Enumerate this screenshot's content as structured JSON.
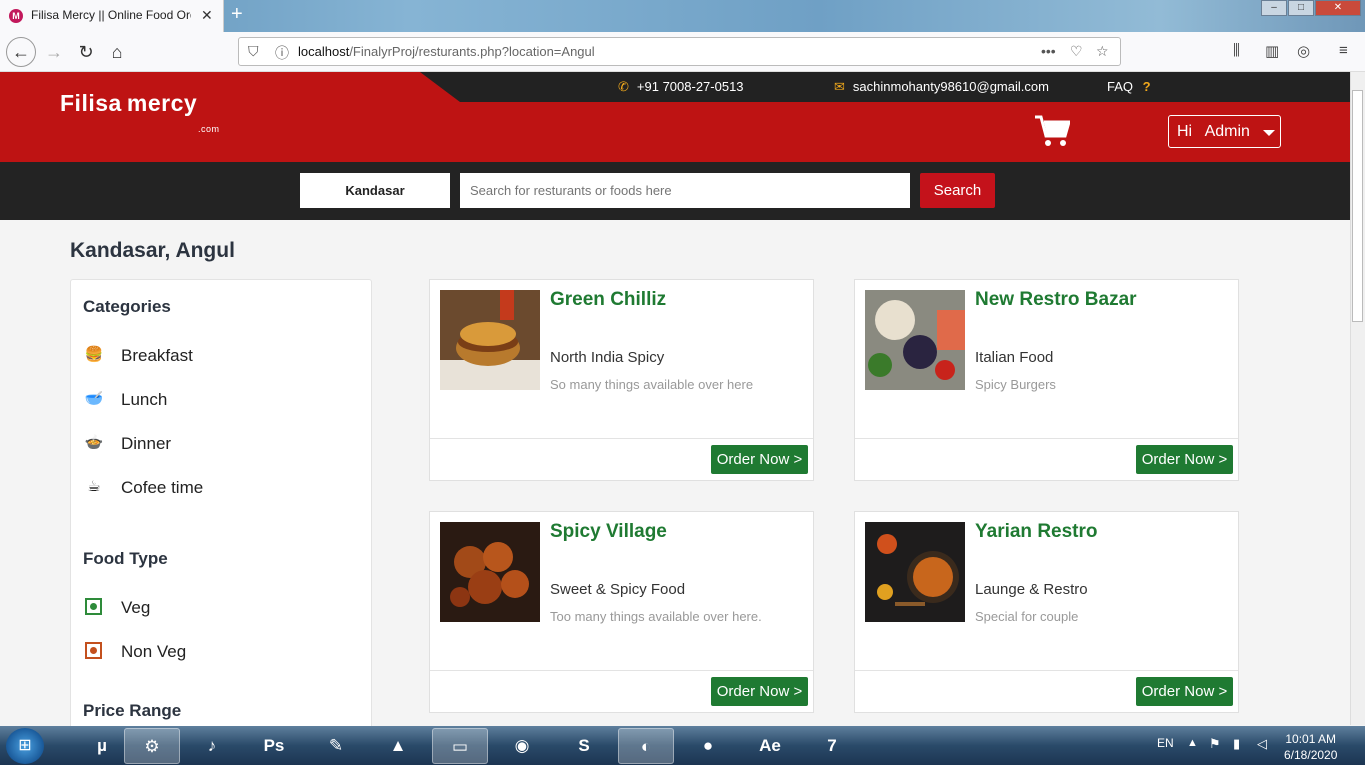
{
  "browser": {
    "tab_title": "Filisa Mercy || Online Food Orde",
    "tab_close": "✕",
    "new_tab": "+",
    "url_prefix": "localhost",
    "url_rest": "/FinalyrProj/resturants.php?location=Angul",
    "window_min": "‒",
    "window_max": "□",
    "window_close": "✕"
  },
  "topbar": {
    "phone": "+91 7008-27-0513",
    "email": "sachinmohanty98610@gmail.com",
    "faq": "FAQ",
    "faq_icon": "?"
  },
  "header": {
    "logo_text": "Filisa mercy",
    "logo_domain": ".com",
    "user_menu": "Hi   Admin"
  },
  "search": {
    "location": "Kandasar",
    "placeholder": "Search for resturants or foods here",
    "button": "Search"
  },
  "page": {
    "title": "Kandasar, Angul"
  },
  "sidebar": {
    "categories_heading": "Categories",
    "categories": [
      {
        "label": "Breakfast",
        "icon": "burger-icon"
      },
      {
        "label": "Lunch",
        "icon": "bowl-icon"
      },
      {
        "label": "Dinner",
        "icon": "dinner-plate-icon"
      },
      {
        "label": "Cofee time",
        "icon": "coffee-cup-icon"
      }
    ],
    "food_type_heading": "Food Type",
    "food_types": [
      {
        "label": "Veg"
      },
      {
        "label": "Non Veg"
      }
    ],
    "price_heading": "Price Range"
  },
  "restaurants": [
    {
      "name": "Green Chilliz",
      "cuisine": "North India Spicy",
      "desc": "So many things available over here",
      "button": "Order Now >"
    },
    {
      "name": "New Restro Bazar",
      "cuisine": "Italian Food",
      "desc": "Spicy Burgers",
      "button": "Order Now >"
    },
    {
      "name": "Spicy Village",
      "cuisine": "Sweet & Spicy Food",
      "desc": "Too many things available over here.",
      "button": "Order Now >"
    },
    {
      "name": "Yarian Restro",
      "cuisine": "Launge & Restro",
      "desc": "Special for couple",
      "button": "Order Now >"
    }
  ],
  "taskbar": {
    "lang": "EN",
    "time": "10:01 AM",
    "date": "6/18/2020",
    "apps": [
      {
        "icon": "utorrent-icon",
        "glyph": "µ"
      },
      {
        "icon": "app-icon",
        "glyph": "⚙"
      },
      {
        "icon": "fl-studio-icon",
        "glyph": "♪"
      },
      {
        "icon": "photoshop-icon",
        "glyph": "Ps"
      },
      {
        "icon": "notepad-icon",
        "glyph": "✎"
      },
      {
        "icon": "vlc-icon",
        "glyph": "▲"
      },
      {
        "icon": "folder-icon",
        "glyph": "▭"
      },
      {
        "icon": "chrome-icon",
        "glyph": "◉"
      },
      {
        "icon": "sublime-icon",
        "glyph": "S"
      },
      {
        "icon": "firefox-icon",
        "glyph": "◐"
      },
      {
        "icon": "media-icon",
        "glyph": "●"
      },
      {
        "icon": "after-effects-icon",
        "glyph": "Ae"
      },
      {
        "icon": "disc-icon",
        "glyph": "7"
      }
    ]
  },
  "colors": {
    "brand_red": "#be1313",
    "green": "#1f7a32",
    "dark": "#232323"
  }
}
